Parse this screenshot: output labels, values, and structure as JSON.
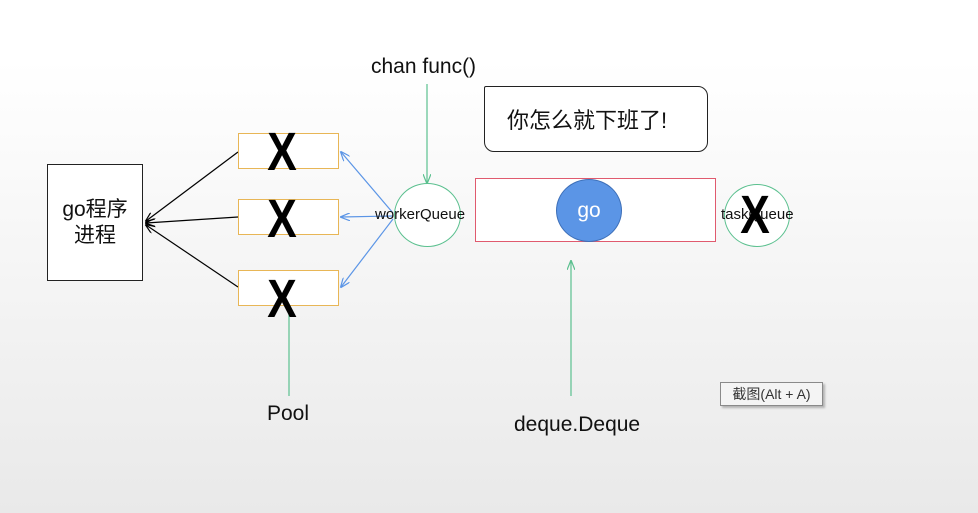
{
  "process": {
    "line1": "go程序",
    "line2": "进程"
  },
  "workers": [
    {
      "mark": "X"
    },
    {
      "mark": "X"
    },
    {
      "mark": "X"
    }
  ],
  "labels": {
    "chan": "chan func()",
    "pool": "Pool",
    "worker_queue": "workerQueue",
    "task_queue": "taskQueue",
    "deque": "deque.Deque",
    "go": "go"
  },
  "task_queue_mark": "X",
  "bubble_text": "你怎么就下班了!",
  "tooltip": "截图(Alt + A)",
  "colors": {
    "worker_border": "#e8b656",
    "green_arrow": "#5bc08f",
    "blue_arrow": "#5b95e6",
    "deque_border": "#e05a6e",
    "go_fill": "#5b95e6"
  }
}
